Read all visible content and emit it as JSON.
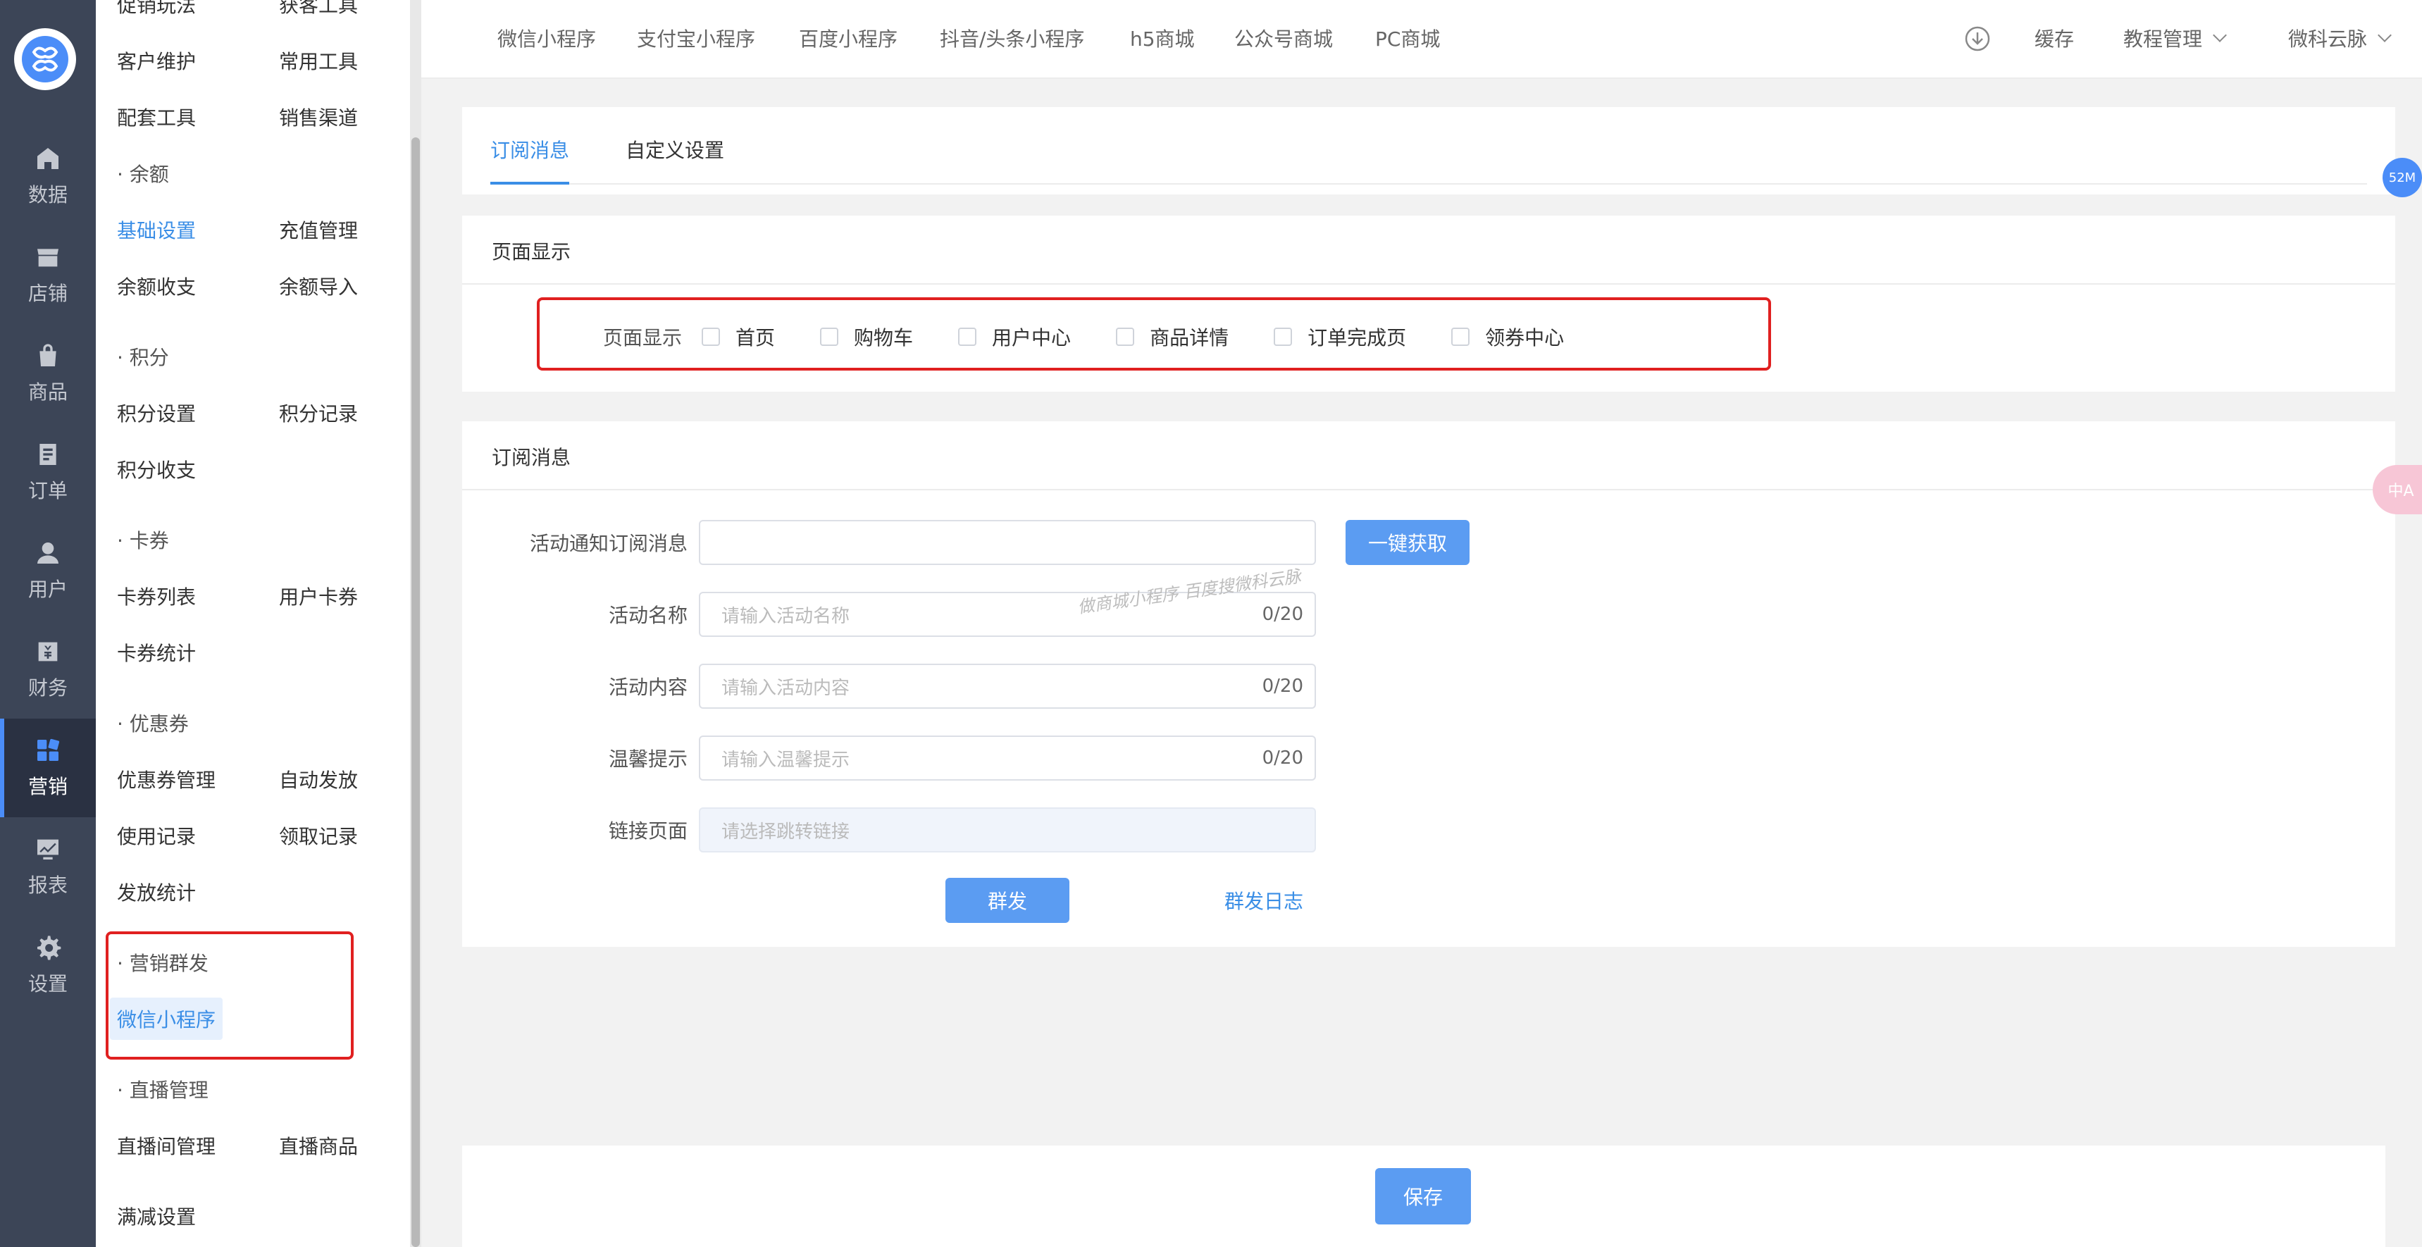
{
  "rail": {
    "items": [
      {
        "label": "数据",
        "icon": "home-icon"
      },
      {
        "label": "店铺",
        "icon": "shop-icon"
      },
      {
        "label": "商品",
        "icon": "bag-icon"
      },
      {
        "label": "订单",
        "icon": "order-icon"
      },
      {
        "label": "用户",
        "icon": "user-icon"
      },
      {
        "label": "财务",
        "icon": "finance-icon"
      },
      {
        "label": "营销",
        "icon": "grid-icon",
        "active": true
      },
      {
        "label": "报表",
        "icon": "report-icon"
      },
      {
        "label": "设置",
        "icon": "gear-icon"
      }
    ]
  },
  "submenu": {
    "top_row": [
      "促销玩法",
      "获客工具"
    ],
    "customer_maint": "客户维护",
    "common_tools": "常用工具",
    "support_tools": "配套工具",
    "sales_channel": "销售渠道",
    "group_balance": "· 余额",
    "basic_settings": "基础设置",
    "recharge_mgmt": "充值管理",
    "balance_io": "余额收支",
    "balance_import": "余额导入",
    "group_points": "· 积分",
    "points_settings": "积分设置",
    "points_record": "积分记录",
    "points_io": "积分收支",
    "group_cards": "· 卡券",
    "card_list": "卡券列表",
    "user_cards": "用户卡券",
    "card_stats": "卡券统计",
    "group_coupons": "· 优惠券",
    "coupon_mgmt": "优惠券管理",
    "auto_issue": "自动发放",
    "usage_record": "使用记录",
    "claim_record": "领取记录",
    "issue_stats": "发放统计",
    "group_marketing_push": "· 营销群发",
    "wechat_mini": "微信小程序",
    "group_live": "· 直播管理",
    "live_room_mgmt": "直播间管理",
    "live_goods": "直播商品",
    "full_reduction": "满减设置"
  },
  "topbar": {
    "nav": [
      "微信小程序",
      "支付宝小程序",
      "百度小程序",
      "抖音/头条小程序",
      "h5商城",
      "公众号商城",
      "PC商城"
    ],
    "cache": "缓存",
    "tutorial": "教程管理",
    "account": "微科云脉"
  },
  "tabs": {
    "subscribe": "订阅消息",
    "custom": "自定义设置"
  },
  "page_display": {
    "title": "页面显示",
    "label": "页面显示",
    "options": [
      "首页",
      "购物车",
      "用户中心",
      "商品详情",
      "订单完成页",
      "领券中心"
    ]
  },
  "subscribe": {
    "title": "订阅消息",
    "activity_notice_label": "活动通知订阅消息",
    "fetch_button": "一键获取",
    "activity_name_label": "活动名称",
    "activity_name_placeholder": "请输入活动名称",
    "activity_name_count": "0/20",
    "activity_content_label": "活动内容",
    "activity_content_placeholder": "请输入活动内容",
    "activity_content_count": "0/20",
    "tip_label": "温馨提示",
    "tip_placeholder": "请输入温馨提示",
    "tip_count": "0/20",
    "link_label": "链接页面",
    "link_placeholder": "请选择跳转链接",
    "send_button": "群发",
    "send_log": "群发日志"
  },
  "watermark": "做商城小程序 百度搜微科云脉",
  "save_button": "保存",
  "memory_badge": "52M",
  "translate_badge": "中A"
}
